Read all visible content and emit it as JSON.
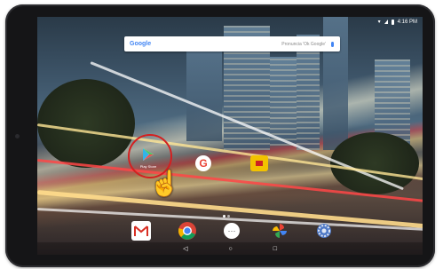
{
  "search": {
    "brand": "Google",
    "hint": "Pronuncia 'Ok Google'"
  },
  "status": {
    "time": "4:16 PM"
  },
  "home_apps": [
    {
      "name": "Play Store",
      "label": "Play Store",
      "icon": "play-store-icon"
    },
    {
      "name": "Google",
      "label": "",
      "icon": "google-icon"
    },
    {
      "name": "Folder",
      "label": "",
      "icon": "folder-icon"
    }
  ],
  "dock": [
    {
      "name": "Gmail",
      "icon": "gmail-icon"
    },
    {
      "name": "Chrome",
      "icon": "chrome-icon"
    },
    {
      "name": "All apps",
      "icon": "app-drawer-icon"
    },
    {
      "name": "Photos",
      "icon": "photos-icon"
    },
    {
      "name": "Settings",
      "icon": "settings-icon"
    }
  ],
  "nav": {
    "back": "◁",
    "home": "○",
    "recents": "□"
  },
  "pages": {
    "count": 2,
    "current": 1
  }
}
